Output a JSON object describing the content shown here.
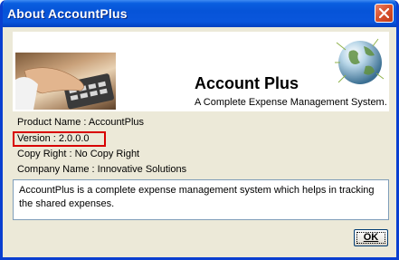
{
  "window": {
    "title": "About AccountPlus"
  },
  "banner": {
    "app_name": "Account Plus",
    "tagline": "A Complete Expense Management System."
  },
  "info": {
    "product_name": "Product Name : AccountPlus",
    "version": "Version : 2.0.0.0",
    "copyright": "Copy Right : No Copy Right",
    "company": "Company Name : Innovative Solutions"
  },
  "description": "AccountPlus is a complete expense management system which helps in tracking the shared expenses.",
  "buttons": {
    "ok_label": "OK"
  },
  "colors": {
    "titlebar": "#0654d8",
    "highlight_box": "#d80000",
    "dialog_bg": "#ece9d8"
  }
}
